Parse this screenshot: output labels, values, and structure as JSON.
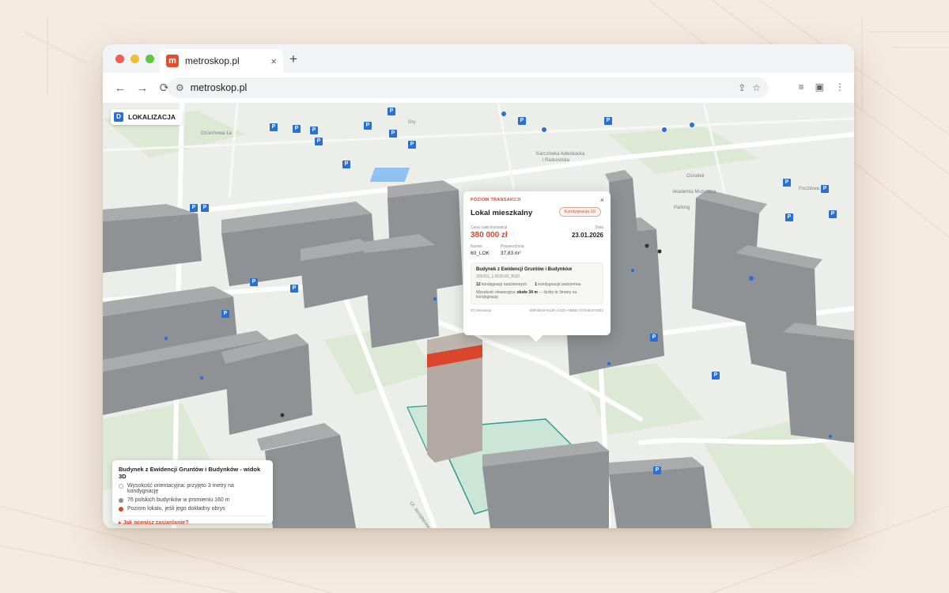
{
  "browser": {
    "tab_title": "metroskop.pl",
    "favicon_letter": "m",
    "url": "metroskop.pl",
    "nav": {
      "back": "←",
      "forward": "→",
      "reload": "⟳"
    },
    "traffic_colors": [
      "#ee5f57",
      "#f4bd2f",
      "#5dc840"
    ],
    "tab_close": "×",
    "new_tab": "+"
  },
  "map": {
    "location_chip": {
      "icon": "D",
      "label": "LOKALIZACJA"
    },
    "parking_label": "P",
    "streets": [
      {
        "text": "Orzechowa 1a"
      },
      {
        "text": "Gry"
      },
      {
        "text": "Karczówka Adwokacka"
      },
      {
        "text": "i Radcowska"
      },
      {
        "text": "Akademia Muzyczna"
      },
      {
        "text": "Parking"
      },
      {
        "text": "Ośrodek"
      },
      {
        "text": "Pocztowa"
      },
      {
        "text": "Ul. Jarzębinowa"
      }
    ]
  },
  "popup": {
    "kicker": "POZIOM TRANSAKCJI",
    "title": "Lokal mieszkalny",
    "badge": "Kondygnacja 10",
    "price_label": "Cena całej transakcji",
    "price": "380 000 zł",
    "date_label": "Data",
    "date": "23.01.2026",
    "number_label": "Numer",
    "number": "60_LOK",
    "area_label": "Powierzchnia",
    "area": "37,83 m²",
    "box_title": "Budynek z Ewidencji Gruntów i Budynków",
    "box_id": "326201_1.0020.82_BUD",
    "floors_above_num": "12",
    "floors_above": "kondygnacji nadziemnych",
    "floors_below_num": "1",
    "floors_below": "kondygnacja podziemna",
    "height_prefix": "Wysokość elewacyjna:",
    "height_value": "około 34 m",
    "height_suffix": "— liczby to 3metry na kondygnację",
    "foot_left": "ID transakcji",
    "foot_right": "65f04616-613D-412D-ABEB-C5TAB1F0301",
    "close": "×"
  },
  "legend": {
    "title": "Budynek z Ewidencji Gruntów i Budynków - widok 3D",
    "items": [
      {
        "text": "Wysokość orientacyjna: przyjęto 3 metry na kondygnację",
        "color": "#ffffff"
      },
      {
        "text": "76 polskich budynków w promieniu 160 m",
        "color": "#8d9092"
      },
      {
        "text": "Poziom lokalu, jeśli jego dokładny obrys",
        "color": "#d9462b"
      }
    ],
    "link": "Jak ocenisz zasianlanie?"
  },
  "colors": {
    "accent": "#d9462b",
    "parking": "#2a6fd6",
    "building": "#9ea1a3",
    "parcel": "#2f9a8e"
  }
}
